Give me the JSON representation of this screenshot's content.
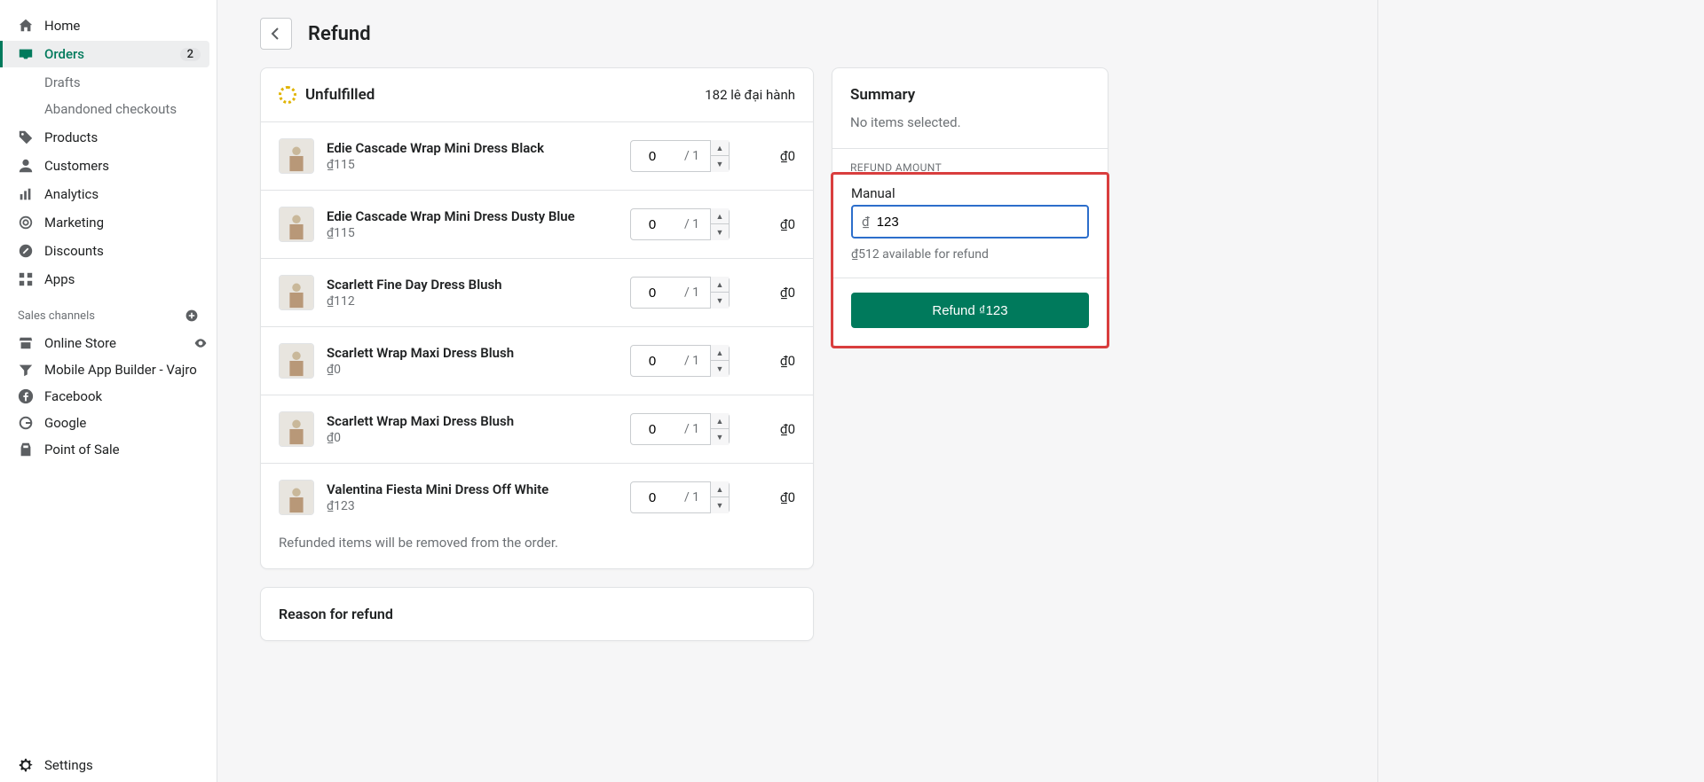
{
  "sidebar": {
    "home": "Home",
    "orders": "Orders",
    "orders_badge": "2",
    "drafts": "Drafts",
    "abandoned": "Abandoned checkouts",
    "products": "Products",
    "customers": "Customers",
    "analytics": "Analytics",
    "marketing": "Marketing",
    "discounts": "Discounts",
    "apps": "Apps",
    "channels_label": "Sales channels",
    "online_store": "Online Store",
    "mobile_app": "Mobile App Builder - Vajro",
    "facebook": "Facebook",
    "google": "Google",
    "pos": "Point of Sale",
    "settings": "Settings"
  },
  "page": {
    "title": "Refund"
  },
  "unfulfilled": {
    "status": "Unfulfilled",
    "location": "182 lê đại hành",
    "items": [
      {
        "title": "Edie Cascade Wrap Mini Dress Black",
        "price": "₫115",
        "qty": "0",
        "max": "1",
        "total": "₫0"
      },
      {
        "title": "Edie Cascade Wrap Mini Dress Dusty Blue",
        "price": "₫115",
        "qty": "0",
        "max": "1",
        "total": "₫0"
      },
      {
        "title": "Scarlett Fine Day Dress Blush",
        "price": "₫112",
        "qty": "0",
        "max": "1",
        "total": "₫0"
      },
      {
        "title": "Scarlett Wrap Maxi Dress Blush",
        "price": "₫0",
        "qty": "0",
        "max": "1",
        "total": "₫0"
      },
      {
        "title": "Scarlett Wrap Maxi Dress Blush",
        "price": "₫0",
        "qty": "0",
        "max": "1",
        "total": "₫0"
      },
      {
        "title": "Valentina Fiesta Mini Dress Off White",
        "price": "₫123",
        "qty": "0",
        "max": "1",
        "total": "₫0"
      }
    ],
    "removed_note": "Refunded items will be removed from the order."
  },
  "reason": {
    "title": "Reason for refund"
  },
  "summary": {
    "title": "Summary",
    "empty": "No items selected.",
    "refund_amount_label": "REFUND AMOUNT",
    "manual_label": "Manual",
    "currency_prefix": "₫",
    "amount_value": "123",
    "available_hint": "₫512 available for refund",
    "button": "Refund ₫123"
  }
}
